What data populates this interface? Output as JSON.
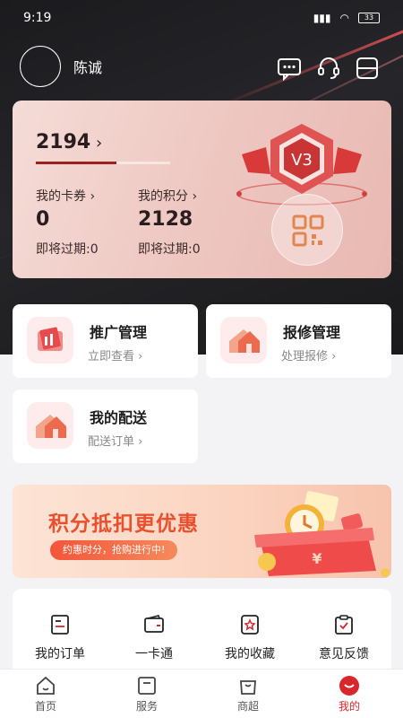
{
  "status_bar": {
    "time": "9:19",
    "battery": "33"
  },
  "user": {
    "name": "陈诚"
  },
  "member_card": {
    "growth_value": "2194",
    "growth_progress": 0.6,
    "level": "V3",
    "coupons": {
      "label": "我的卡券 ›",
      "value": "0",
      "expiring": "即将过期:0"
    },
    "points": {
      "label": "我的积分 ›",
      "value": "2128",
      "expiring": "即将过期:0"
    }
  },
  "tiles": [
    {
      "title": "推广管理",
      "sub": "立即查看 ›"
    },
    {
      "title": "报修管理",
      "sub": "处理报修 ›"
    },
    {
      "title": "我的配送",
      "sub": "配送订单 ›"
    }
  ],
  "banner": {
    "title": "积分抵扣更优惠",
    "subtitle": "约惠时分，抢购进行中!"
  },
  "services": [
    {
      "label": "我的订单",
      "icon": "order-icon"
    },
    {
      "label": "一卡通",
      "icon": "card-icon"
    },
    {
      "label": "我的收藏",
      "icon": "favorite-icon"
    },
    {
      "label": "意见反馈",
      "icon": "feedback-icon"
    }
  ],
  "tabbar": [
    {
      "label": "首页",
      "icon": "home-icon"
    },
    {
      "label": "服务",
      "icon": "service-icon"
    },
    {
      "label": "商超",
      "icon": "shop-icon"
    },
    {
      "label": "我的",
      "icon": "profile-icon",
      "active": true
    }
  ],
  "colors": {
    "accent": "#d8262c",
    "banner_text": "#e8502e",
    "card_bg": "#eec7c1"
  }
}
